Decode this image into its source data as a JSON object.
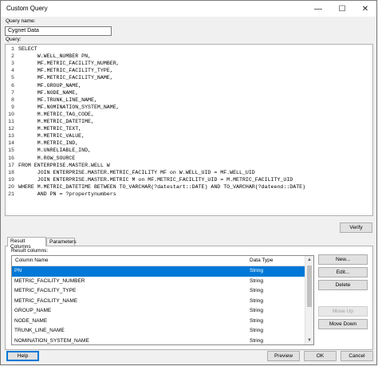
{
  "window": {
    "title": "Custom Query"
  },
  "window_controls": {
    "minimize": "—",
    "maximize": "☐",
    "close": "✕"
  },
  "query_name": {
    "label": "Query name:",
    "value": "Cygnet Data"
  },
  "query": {
    "label": "Query:"
  },
  "code_lines": [
    {
      "n": "1",
      "text": "SELECT"
    },
    {
      "n": "2",
      "text": "      W.WELL_NUMBER PN,"
    },
    {
      "n": "3",
      "text": "      MF.METRIC_FACILITY_NUMBER,"
    },
    {
      "n": "4",
      "text": "      MF.METRIC_FACILITY_TYPE,"
    },
    {
      "n": "5",
      "text": "      MF.METRIC_FACILITY_NAME,"
    },
    {
      "n": "6",
      "text": "      MF.GROUP_NAME,"
    },
    {
      "n": "7",
      "text": "      MF.NODE_NAME,"
    },
    {
      "n": "8",
      "text": "      MF.TRUNK_LINE_NAME,"
    },
    {
      "n": "9",
      "text": "      MF.NOMINATION_SYSTEM_NAME,"
    },
    {
      "n": "10",
      "text": "      M.METRIC_TAG_CODE,"
    },
    {
      "n": "11",
      "text": "      M.METRIC_DATETIME,"
    },
    {
      "n": "12",
      "text": "      M.METRIC_TEXT,"
    },
    {
      "n": "13",
      "text": "      M.METRIC_VALUE,"
    },
    {
      "n": "14",
      "text": "      M.METRIC_IND,"
    },
    {
      "n": "15",
      "text": "      M.UNRELIABLE_IND,"
    },
    {
      "n": "16",
      "text": "      M.ROW_SOURCE"
    },
    {
      "n": "17",
      "text": "FROM ENTERPRISE.MASTER.WELL W"
    },
    {
      "n": "18",
      "text": "      JOIN ENTERPRISE.MASTER.METRIC_FACILITY MF on W.WELL_UID = MF.WELL_UID"
    },
    {
      "n": "19",
      "text": "      JOIN ENTERPRISE.MASTER.METRIC M on MF.METRIC_FACILITY_UID = M.METRIC_FACILITY_UID"
    },
    {
      "n": "20",
      "text": "WHERE M.METRIC_DATETIME BETWEEN TO_VARCHAR(?datestart::DATE) AND TO_VARCHAR(?dateend::DATE)"
    },
    {
      "n": "21",
      "text": "      AND PN = ?propertynumbers"
    }
  ],
  "verify_button": "Verify",
  "tabs": {
    "result_columns": "Result Columns",
    "parameters": "Parameters"
  },
  "result_columns_label": "Result columns:",
  "grid": {
    "headers": {
      "column_name": "Column Name",
      "data_type": "Data Type"
    },
    "rows": [
      {
        "name": "PN",
        "type": "String"
      },
      {
        "name": "METRIC_FACILITY_NUMBER",
        "type": "String"
      },
      {
        "name": "METRIC_FACILITY_TYPE",
        "type": "String"
      },
      {
        "name": "METRIC_FACILITY_NAME",
        "type": "String"
      },
      {
        "name": "GROUP_NAME",
        "type": "String"
      },
      {
        "name": "NODE_NAME",
        "type": "String"
      },
      {
        "name": "TRUNK_LINE_NAME",
        "type": "String"
      },
      {
        "name": "NOMINATION_SYSTEM_NAME",
        "type": "String"
      }
    ],
    "selected_index": 0
  },
  "side_buttons": {
    "new": "New...",
    "edit": "Edit...",
    "delete": "Delete",
    "move_up": "Move Up",
    "move_down": "Move Down"
  },
  "bottom_buttons": {
    "help": "Help",
    "preview": "Preview",
    "ok": "OK",
    "cancel": "Cancel"
  },
  "scroll_icons": {
    "up": "▲",
    "down": "▼"
  },
  "colors": {
    "selection": "#0078d7",
    "background": "#f0f0f0"
  }
}
